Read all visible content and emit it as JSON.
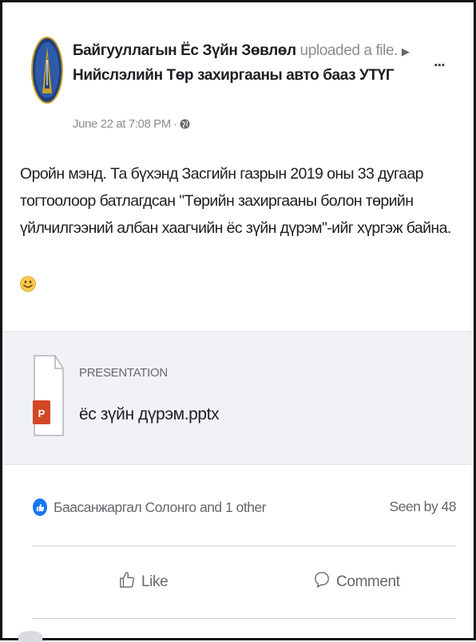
{
  "post": {
    "author": "Байгууллагын Ёс Зүйн Зөвлөл",
    "action": "uploaded a file.",
    "arrow_icon": "triangle-right-icon",
    "group": "Нийслэлийн Төр захиргааны авто бааз УТҮГ",
    "timestamp": "June 22 at 7:08 PM",
    "separator": "·",
    "audience_icon": "globe-icon",
    "more_label": "...",
    "body": "Оройн мэнд. Та бүхэнд Засгийн газрын 2019 оны 33 дугаар тогтоолоор батлагдсан \"Төрийн захиргааны болон төрийн үйлчилгээний албан хаагчийн ёс зүйн дүрэм\"-ийг хүргэж байна.",
    "emoji_icon": "smile-emoji-icon"
  },
  "attachment": {
    "type_label": "PRESENTATION",
    "file_name": "ёс зүйн дүрэм.pptx",
    "icon": "powerpoint-file-icon",
    "icon_letter": "P"
  },
  "reactions": {
    "icon": "like-reaction-icon",
    "text": "Баасанжаргал Солонго and 1 other",
    "seen_by": "Seen by 48"
  },
  "actions": {
    "like_label": "Like",
    "like_icon": "thumbs-up-icon",
    "comment_label": "Comment",
    "comment_icon": "comment-bubble-icon"
  },
  "colors": {
    "accent": "#1877f2",
    "muted_text": "#65676b",
    "attachment_bg": "#f0f2f5",
    "ppt_red": "#d24726"
  }
}
